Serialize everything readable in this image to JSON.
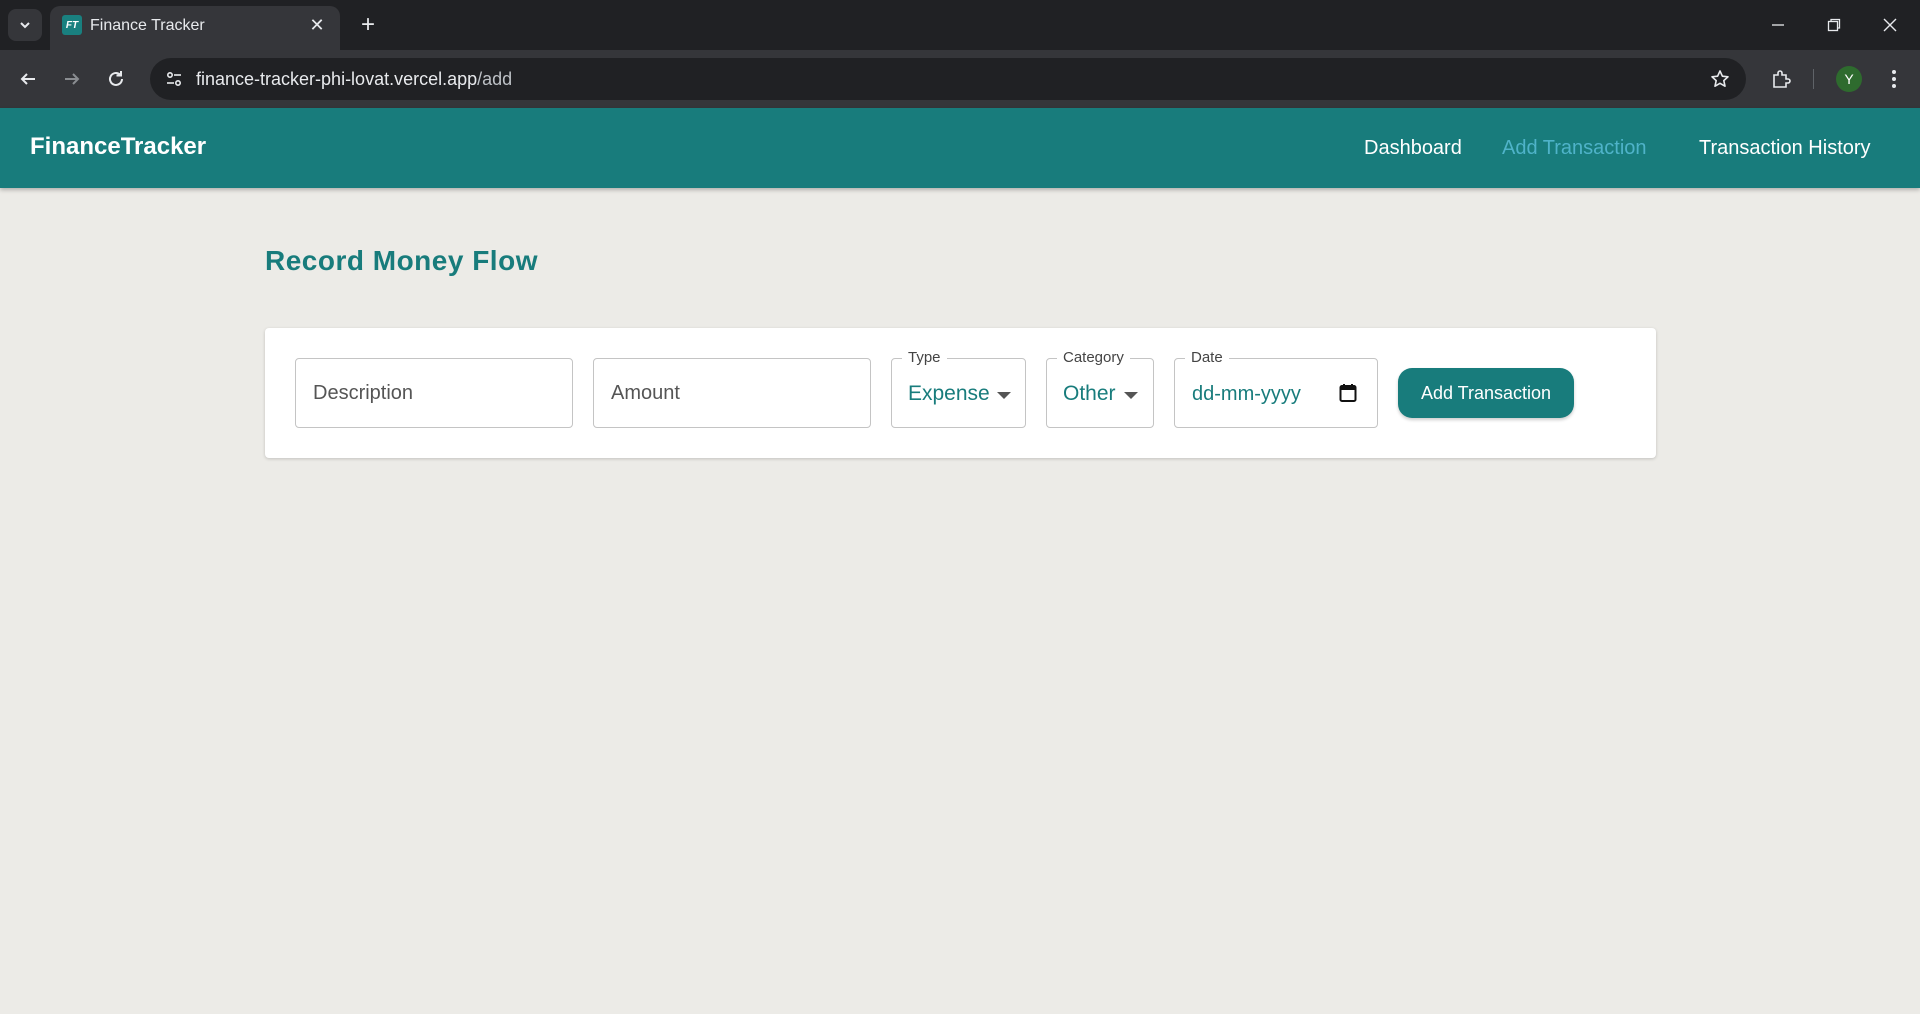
{
  "browser": {
    "tab_title": "Finance Tracker",
    "favicon_text": "FT",
    "url_host": "finance-tracker-phi-lovat.vercel.app",
    "url_path": "/add",
    "profile_initial": "Y"
  },
  "header": {
    "brand": "FinanceTracker",
    "nav": [
      {
        "label": "Dashboard"
      },
      {
        "label": "Add Transaction"
      },
      {
        "label": "Transaction History"
      }
    ],
    "active_color": "#4fb3c9",
    "bg_color": "#187c7c"
  },
  "main": {
    "title": "Record Money Flow",
    "form": {
      "description_placeholder": "Description",
      "amount_placeholder": "Amount",
      "type_label": "Type",
      "type_value": "Expense",
      "category_label": "Category",
      "category_value": "Other",
      "date_label": "Date",
      "date_placeholder": "dd-mm-yyyy",
      "submit_label": "Add Transaction"
    }
  }
}
